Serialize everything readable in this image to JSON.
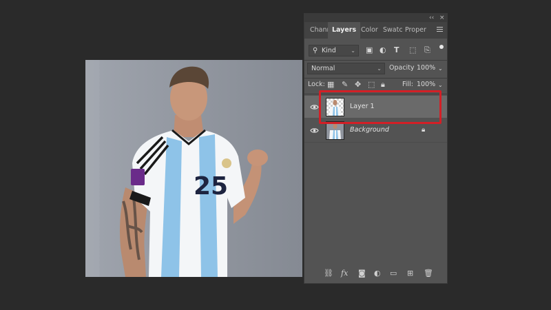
{
  "panel": {
    "topbar": {
      "collapse": "‹‹",
      "close": "×"
    },
    "tabs": [
      {
        "label": "Chann"
      },
      {
        "label": "Layers"
      },
      {
        "label": "Color"
      },
      {
        "label": "Swatc"
      },
      {
        "label": "Proper"
      }
    ],
    "filter": {
      "value": "Kind",
      "icon": "search-icon"
    },
    "blend_mode": {
      "value": "Normal"
    },
    "opacity": {
      "label": "Opacity:",
      "value": "100%"
    },
    "lock": {
      "label": "Lock:"
    },
    "fill": {
      "label": "Fill:",
      "value": "100%"
    },
    "layers": [
      {
        "name": "Layer 1",
        "visible": true,
        "selected": true
      },
      {
        "name": "Background",
        "visible": true,
        "selected": false,
        "locked": true
      }
    ],
    "bottom_icons": [
      "link-icon",
      "fx-icon",
      "mask-icon",
      "adjustment-icon",
      "folder-icon",
      "new-layer-icon",
      "trash-icon"
    ],
    "fx_label": "fx"
  },
  "colors": {
    "app_background": "#2a2a2a",
    "panel_background": "#535353",
    "selected_layer": "#6a6a6a",
    "highlight_box": "#d31f26"
  },
  "canvas": {
    "jersey_number": "25"
  }
}
